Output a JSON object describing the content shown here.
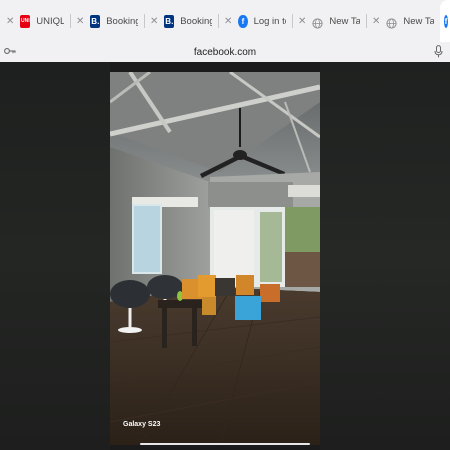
{
  "browser": {
    "tabs": [
      {
        "label": "UNIQLO",
        "favicon": "uniqlo-favicon",
        "fav_text": "UNI",
        "fav_color": "#e60012"
      },
      {
        "label": "Booking.com",
        "favicon": "booking-favicon",
        "fav_text": "B.",
        "fav_color": "#003580"
      },
      {
        "label": "Booking.com",
        "favicon": "booking-favicon",
        "fav_text": "B.",
        "fav_color": "#003580"
      },
      {
        "label": "Log in to Fac",
        "favicon": "facebook-favicon",
        "fav_text": "f",
        "fav_color": "#1877f2"
      },
      {
        "label": "New Tab",
        "favicon": "globe-icon",
        "fav_text": "",
        "fav_color": "#8e8e93"
      },
      {
        "label": "New Tab",
        "favicon": "globe-icon",
        "fav_text": "",
        "fav_color": "#8e8e93"
      },
      {
        "label": "",
        "favicon": "facebook-favicon",
        "fav_text": "f",
        "fav_color": "#1877f2"
      }
    ],
    "close_glyph": "✕",
    "url": "facebook.com"
  },
  "video": {
    "caption": "Galaxy S23"
  }
}
